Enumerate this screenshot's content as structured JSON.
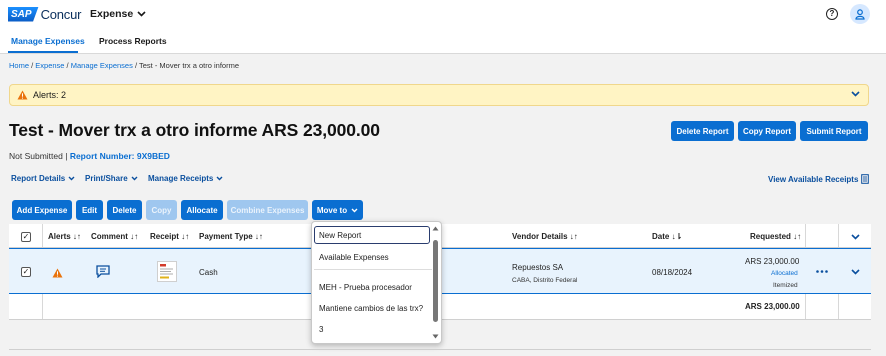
{
  "app": {
    "brand_sap": "SAP",
    "brand_name": "Concur",
    "module": "Expense"
  },
  "subnav": {
    "tabs": [
      {
        "label": "Manage Expenses",
        "active": true
      },
      {
        "label": "Process Reports",
        "active": false
      }
    ]
  },
  "breadcrumb": {
    "home": "Home",
    "expense": "Expense",
    "manage": "Manage Expenses",
    "current": "Test - Mover trx a otro informe",
    "sep": " / "
  },
  "alert": {
    "text": "Alerts: 2"
  },
  "report": {
    "title": "Test - Mover trx a otro informe ARS 23,000.00",
    "status": "Not Submitted |",
    "number_label": "Report Number: 9X9BED"
  },
  "top_buttons": {
    "delete": "Delete Report",
    "copy": "Copy Report",
    "submit": "Submit Report"
  },
  "menus": {
    "details": "Report Details",
    "print": "Print/Share",
    "receipts": "Manage Receipts",
    "view_receipts": "View Available Receipts"
  },
  "toolbar": {
    "add": "Add Expense",
    "edit": "Edit",
    "delete": "Delete",
    "copy": "Copy",
    "allocate": "Allocate",
    "combine": "Combine Expenses",
    "move": "Move to"
  },
  "table": {
    "headers": {
      "alerts": "Alerts",
      "comment": "Comment",
      "receipt": "Receipt",
      "payment": "Payment Type",
      "vendor": "Vendor Details",
      "date": "Date",
      "requested": "Requested"
    },
    "row": {
      "payment": "Cash",
      "vendor": "Repuestos SA",
      "vendor_loc": "CABA, Distrito Federal",
      "date": "08/18/2024",
      "amount": "ARS 23,000.00",
      "allocated": "Allocated",
      "itemized": "Itemized"
    },
    "total": "ARS 23,000.00"
  },
  "move_to_menu": {
    "items": [
      "New Report",
      "Available Expenses",
      "MEH - Prueba procesador",
      "Mantiene cambios de las trx?",
      "3"
    ]
  },
  "colors": {
    "primary": "#0a6ed1",
    "alert_bg": "#fff4c4",
    "warning": "#e9730c"
  }
}
